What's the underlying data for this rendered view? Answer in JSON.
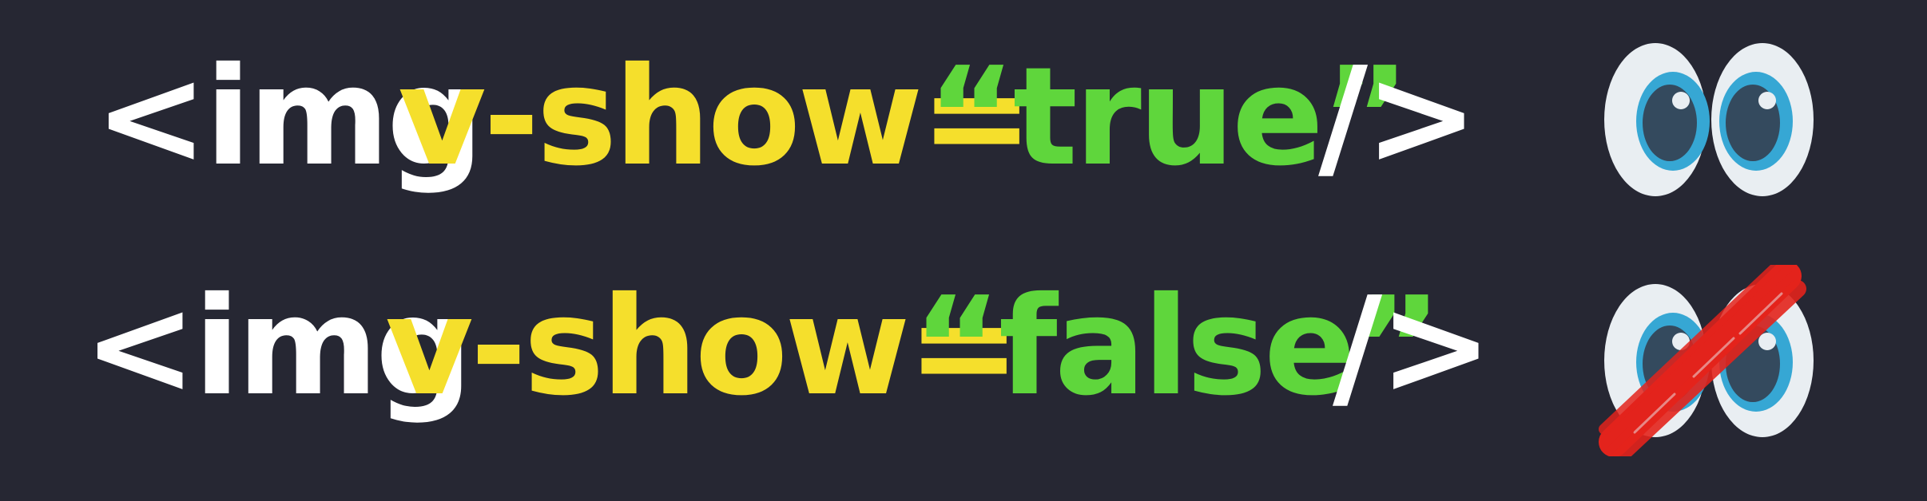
{
  "colors": {
    "background": "#262733",
    "tag": "#ffffff",
    "attribute": "#f5df2c",
    "value": "#5fd63c",
    "eye_white": "#e9eef2",
    "iris": "#36a7d4",
    "pupil": "#344a5e",
    "cross_out": "#e3231c"
  },
  "lines": [
    {
      "open": "<img",
      "attr": "v-show=",
      "value": "“true”",
      "close": "/>",
      "icon": "eyes-icon"
    },
    {
      "open": "<img",
      "attr": "v-show=",
      "value": "“false”",
      "close": "/>",
      "icon": "crossed-out-eyes-icon"
    }
  ]
}
